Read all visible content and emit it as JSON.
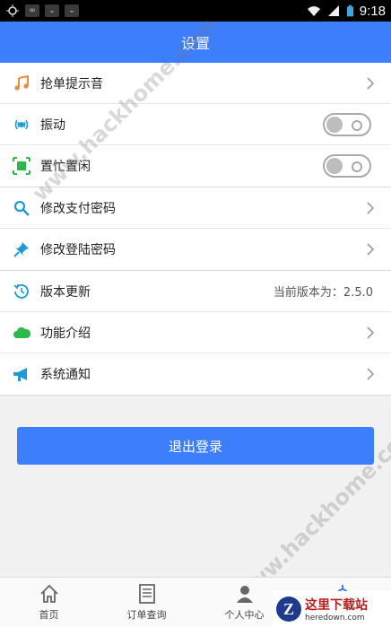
{
  "status_bar": {
    "time": "9:18"
  },
  "header": {
    "title": "设置"
  },
  "settings": {
    "group1": [
      {
        "label": "抢单提示音",
        "icon": "music-note-icon",
        "control": "chevron"
      },
      {
        "label": "振动",
        "icon": "vibration-icon",
        "control": "toggle",
        "on": false
      },
      {
        "label": "置忙置闲",
        "icon": "busy-status-icon",
        "control": "toggle",
        "on": false
      }
    ],
    "group2": [
      {
        "label": "修改支付密码",
        "icon": "search-icon",
        "control": "chevron"
      },
      {
        "label": "修改登陆密码",
        "icon": "pin-icon",
        "control": "chevron"
      }
    ],
    "group3": [
      {
        "label": "版本更新",
        "icon": "history-icon",
        "control": "value",
        "value": "当前版本为：2.5.0"
      },
      {
        "label": "功能介绍",
        "icon": "cloud-icon",
        "control": "chevron"
      },
      {
        "label": "系统通知",
        "icon": "megaphone-icon",
        "control": "chevron"
      }
    ]
  },
  "logout_label": "退出登录",
  "tabbar": {
    "tabs": [
      {
        "label": "首页",
        "icon": "home-icon"
      },
      {
        "label": "订单查询",
        "icon": "order-document-icon"
      },
      {
        "label": "个人中心",
        "icon": "person-icon"
      },
      {
        "label": "",
        "icon": "settings-icon"
      }
    ]
  },
  "watermark": {
    "text": "www.hackhome.com"
  },
  "corner_badge": {
    "letter": "Z",
    "title": "这里下载站",
    "subtitle": "heredown.com"
  },
  "colors": {
    "accent": "#3d7efc",
    "music_icon": "#f08a3c",
    "green_icon": "#2db84b",
    "blue_icon": "#1e9bd7"
  }
}
